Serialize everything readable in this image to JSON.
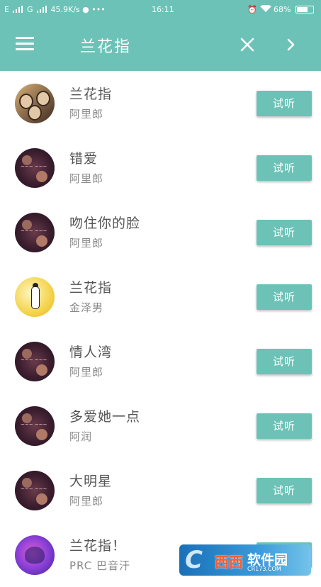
{
  "status_bar": {
    "left": "E",
    "left2": "G",
    "speed": "45.9K/s",
    "time": "16:11",
    "battery": "68%"
  },
  "toolbar": {
    "title": "兰花指"
  },
  "icons": {
    "menu": "menu-icon",
    "close": "close-icon",
    "next": "chevron-right-icon",
    "alarm": "alarm-icon",
    "wifi": "wifi-icon",
    "battery": "battery-icon"
  },
  "colors": {
    "accent": "#6cc2b6"
  },
  "songs": [
    {
      "title": "兰花指",
      "artist": "阿里郎",
      "button": "试听"
    },
    {
      "title": "错爱",
      "artist": "阿里郎",
      "button": "试听"
    },
    {
      "title": "吻住你的脸",
      "artist": "阿里郎",
      "button": "试听"
    },
    {
      "title": "兰花指",
      "artist": "金泽男",
      "button": "试听"
    },
    {
      "title": "情人湾",
      "artist": "阿里郎",
      "button": "试听"
    },
    {
      "title": "多爱她一点",
      "artist": "阿润",
      "button": "试听"
    },
    {
      "title": "大明星",
      "artist": "阿里郎",
      "button": "试听"
    },
    {
      "title": "兰花指！",
      "artist": "PRC 巴音汗",
      "button": "试听"
    }
  ],
  "watermark": {
    "brand": "西西",
    "name": "软件园",
    "url": "CR173.COM"
  }
}
